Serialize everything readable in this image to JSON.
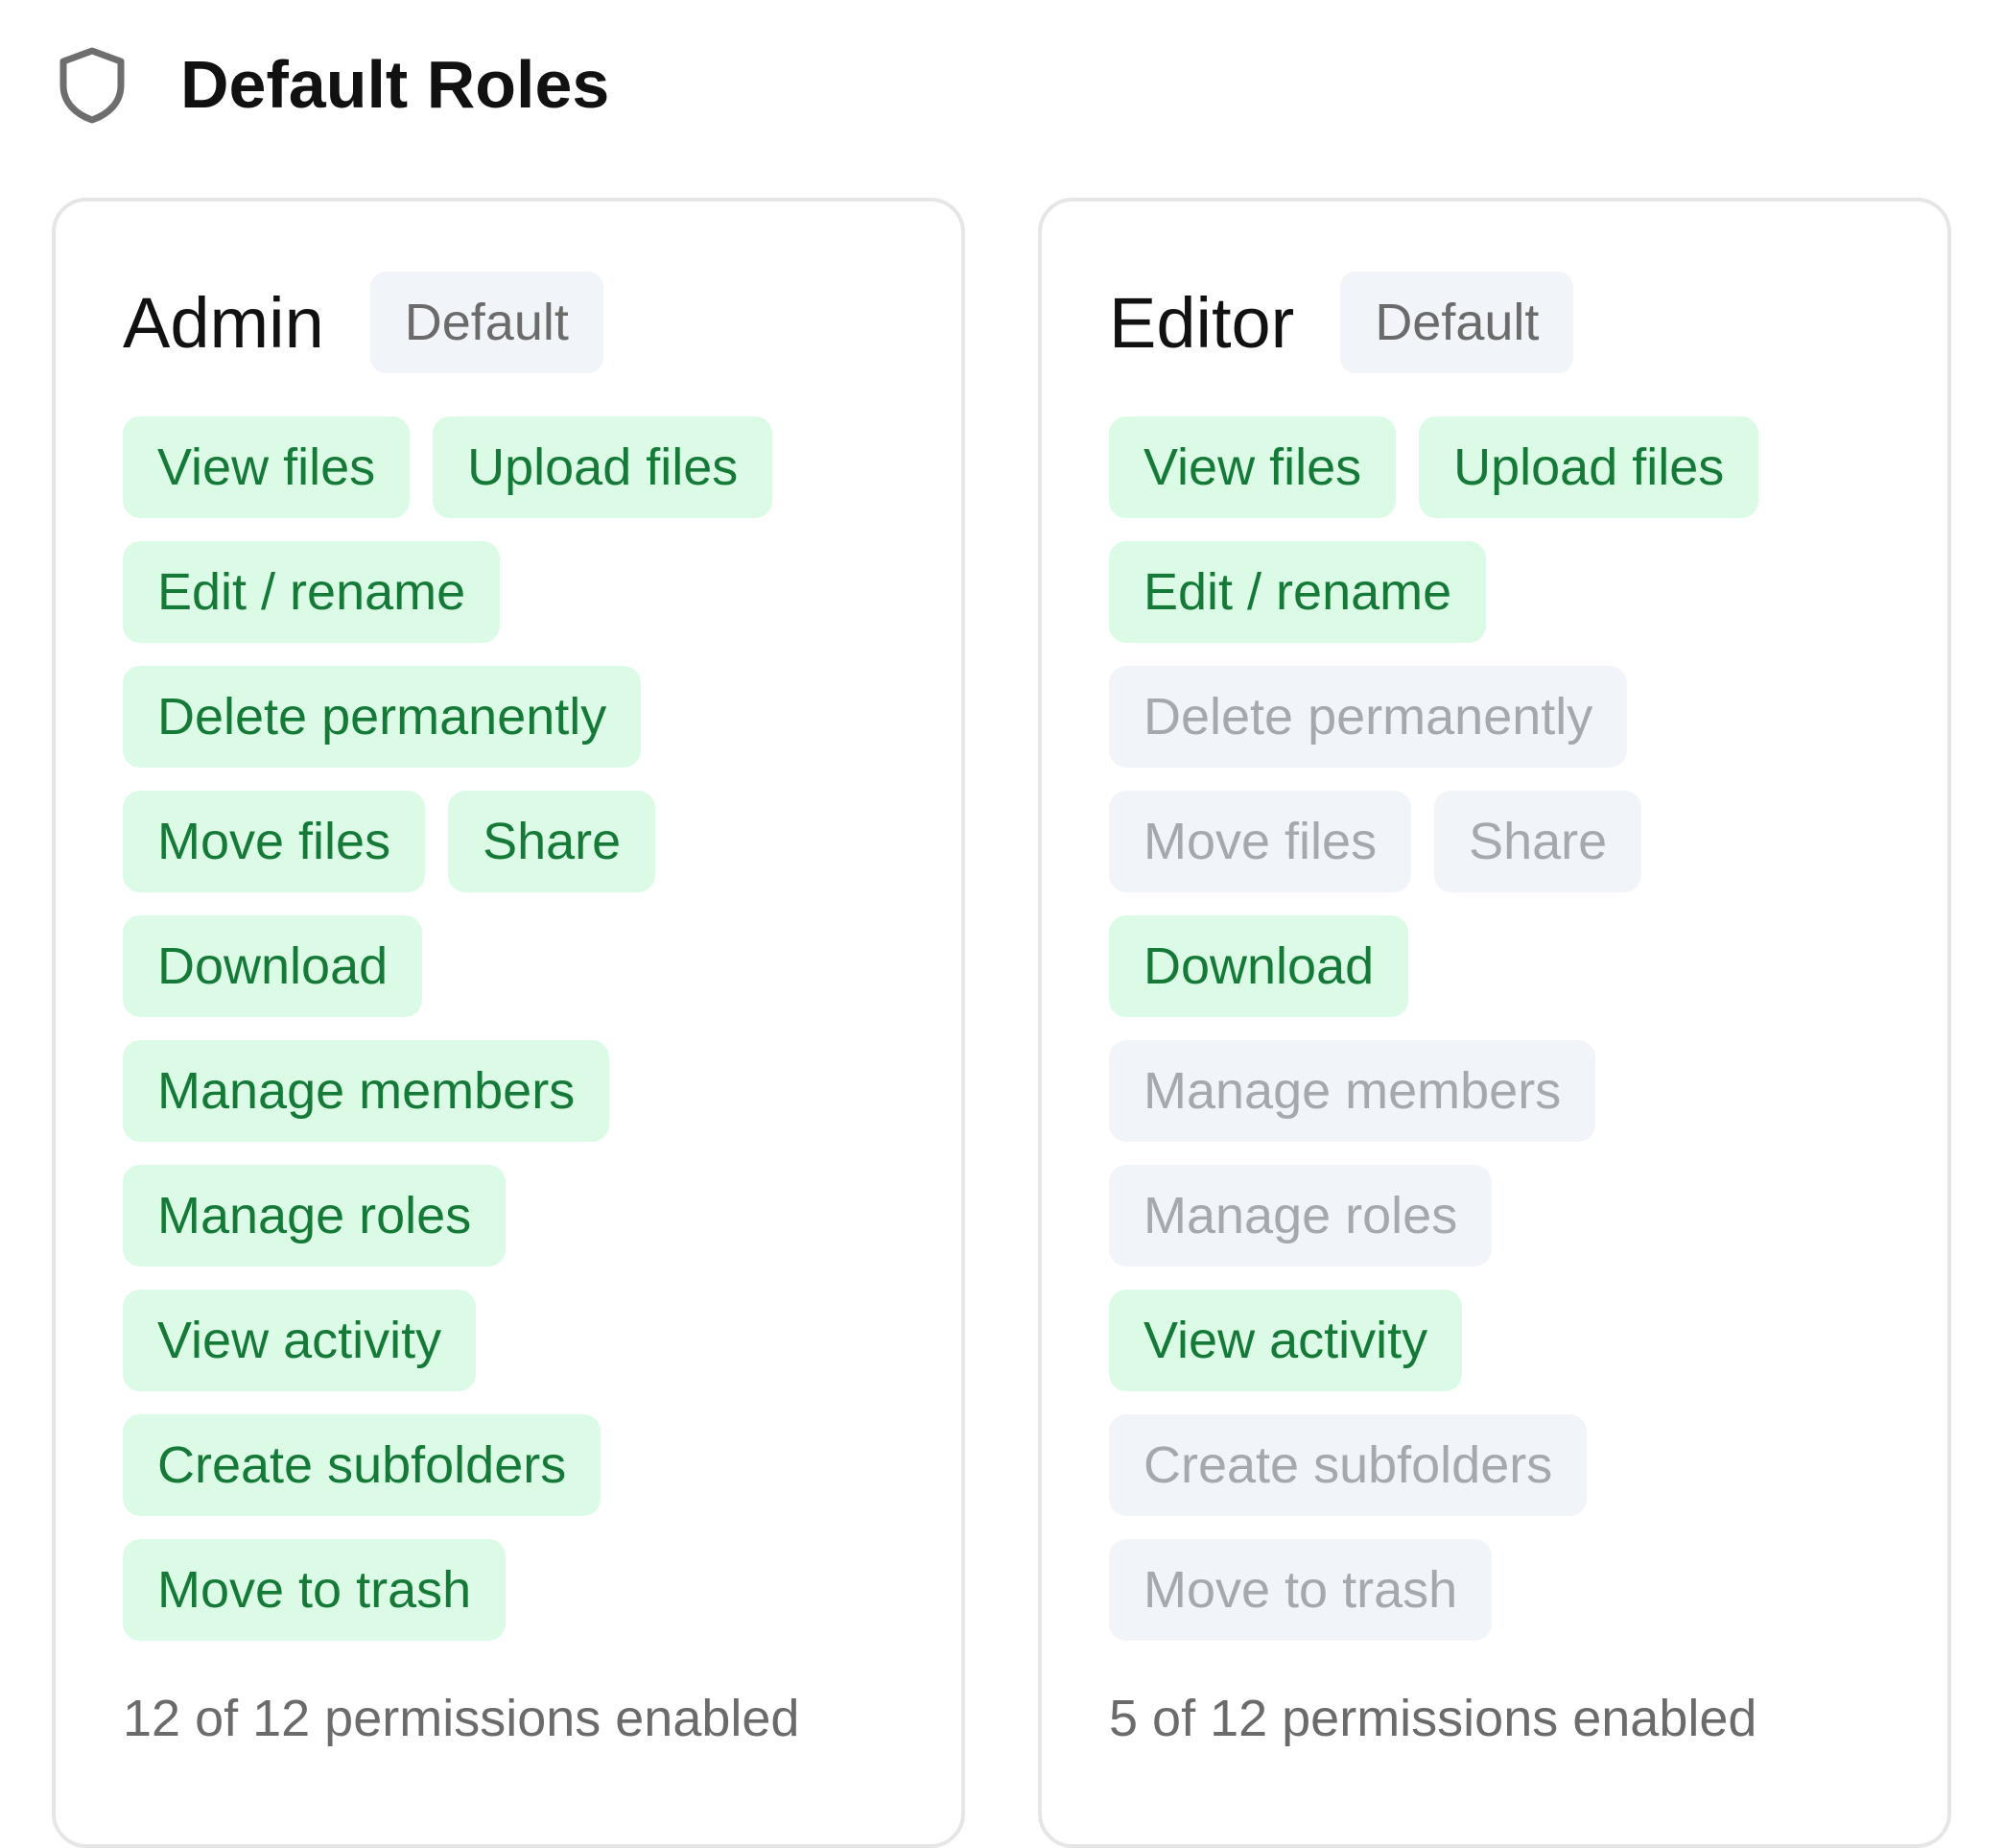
{
  "header": {
    "title": "Default Roles",
    "icon": "shield-icon"
  },
  "colors": {
    "enabled_bg": "#dcfbe6",
    "enabled_text": "#157a37",
    "disabled_bg": "#f1f4f8",
    "disabled_text": "#a5a8ad",
    "card_border": "#e6e6e6",
    "badge_bg": "#f1f4f8"
  },
  "roles": [
    {
      "name": "Admin",
      "badge": "Default",
      "summary": "12 of 12 permissions enabled",
      "permissions": [
        {
          "label": "View files",
          "enabled": true
        },
        {
          "label": "Upload files",
          "enabled": true
        },
        {
          "label": "Edit / rename",
          "enabled": true
        },
        {
          "label": "Delete permanently",
          "enabled": true
        },
        {
          "label": "Move files",
          "enabled": true
        },
        {
          "label": "Share",
          "enabled": true
        },
        {
          "label": "Download",
          "enabled": true
        },
        {
          "label": "Manage members",
          "enabled": true
        },
        {
          "label": "Manage roles",
          "enabled": true
        },
        {
          "label": "View activity",
          "enabled": true
        },
        {
          "label": "Create subfolders",
          "enabled": true
        },
        {
          "label": "Move to trash",
          "enabled": true
        }
      ]
    },
    {
      "name": "Editor",
      "badge": "Default",
      "summary": "5 of 12 permissions enabled",
      "permissions": [
        {
          "label": "View files",
          "enabled": true
        },
        {
          "label": "Upload files",
          "enabled": true
        },
        {
          "label": "Edit / rename",
          "enabled": true
        },
        {
          "label": "Delete permanently",
          "enabled": false
        },
        {
          "label": "Move files",
          "enabled": false
        },
        {
          "label": "Share",
          "enabled": false
        },
        {
          "label": "Download",
          "enabled": true
        },
        {
          "label": "Manage members",
          "enabled": false
        },
        {
          "label": "Manage roles",
          "enabled": false
        },
        {
          "label": "View activity",
          "enabled": true
        },
        {
          "label": "Create subfolders",
          "enabled": false
        },
        {
          "label": "Move to trash",
          "enabled": false
        }
      ]
    }
  ]
}
